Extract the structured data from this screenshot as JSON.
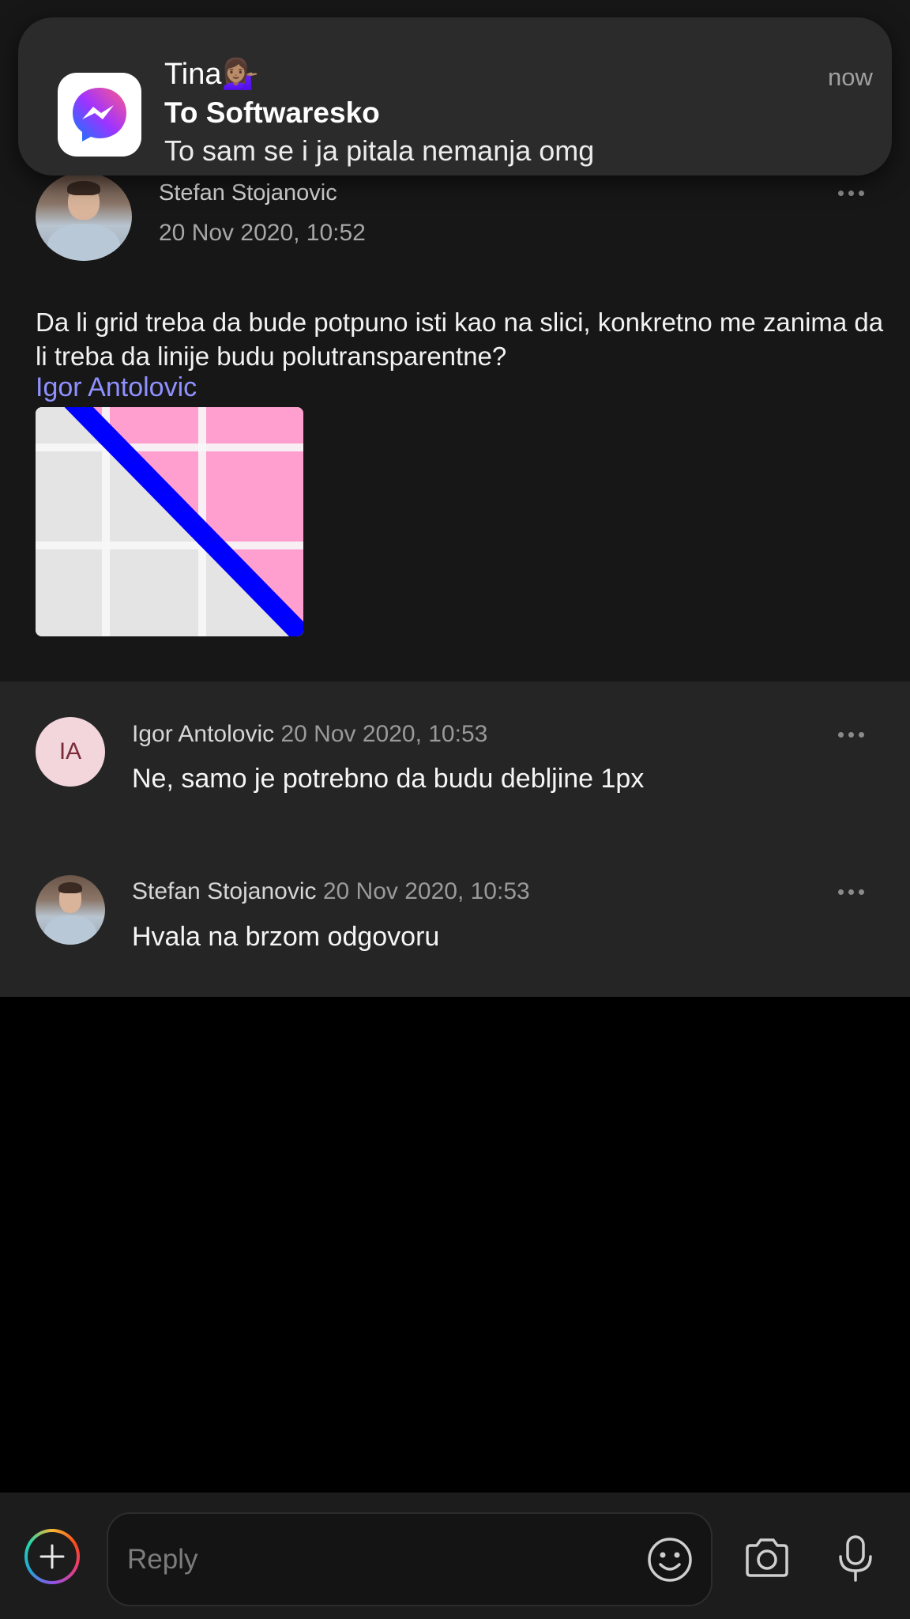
{
  "notification": {
    "sender": "Tina💁🏽‍♀️",
    "title": "To Softwaresko",
    "body": "To sam se i ja pitala nemanja omg",
    "time": "now",
    "app_icon": "messenger-icon"
  },
  "post": {
    "author": "Stefan Stojanovic",
    "timestamp": "20 Nov 2020, 10:52",
    "text": "Da li grid treba da bude  potpuno isti kao na slici, konkretno me zanima da li treba da linije budu polutransparentne?",
    "mention": "Igor Antolovic",
    "attachment": "grid-screenshot-image"
  },
  "comments": [
    {
      "avatar_initials": "IA",
      "author": "Igor Antolovic",
      "timestamp": "20 Nov 2020, 10:53",
      "text": "Ne, samo je potrebno da budu debljine 1px"
    },
    {
      "author": "Stefan Stojanovic",
      "timestamp": "20 Nov 2020, 10:53",
      "text": "Hvala na brzom odgovoru"
    }
  ],
  "reply_bar": {
    "placeholder": "Reply",
    "icons": [
      "add-icon",
      "emoji-icon",
      "camera-icon",
      "microphone-icon"
    ]
  },
  "colors": {
    "mention": "#8f91ff",
    "post_background": "#171717",
    "comments_background": "#252525",
    "attachment_line": "#0000ff",
    "attachment_pink": "#ff9fcf"
  }
}
